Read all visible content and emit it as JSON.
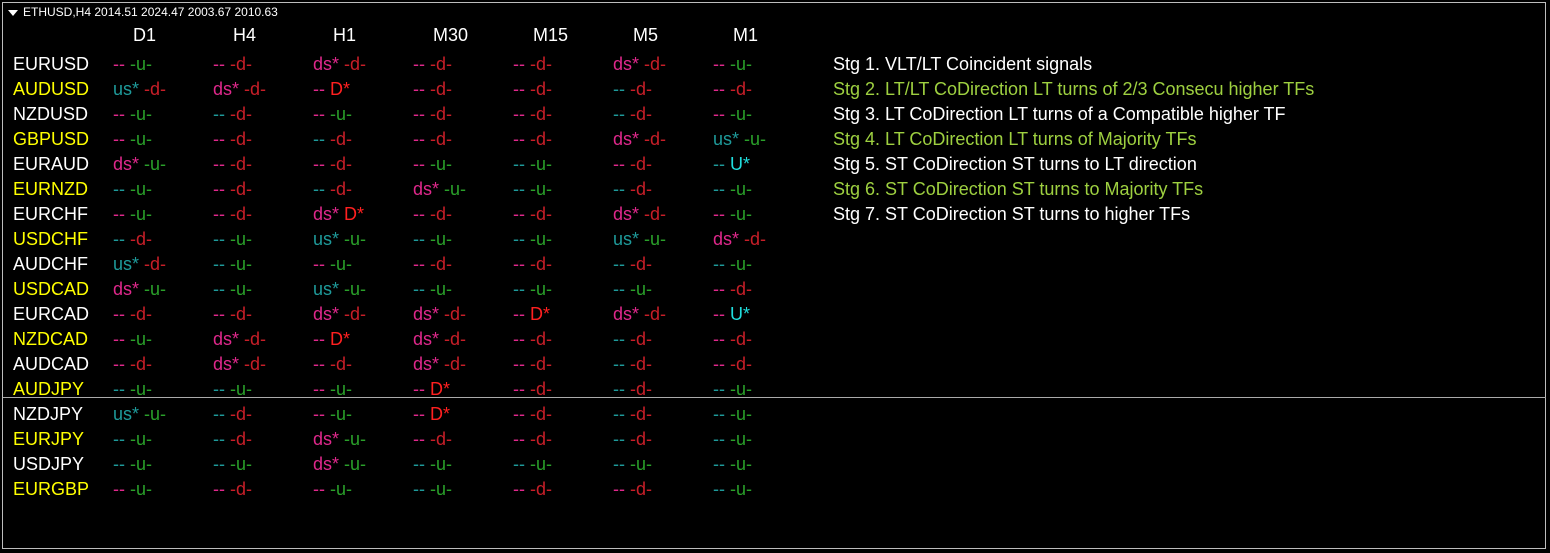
{
  "window_title": "ETHUSD,H4  2014.51 2024.47 2003.67 2010.63",
  "colors": {
    "bg": "#000000",
    "white": "#ffffff",
    "yellow": "#ffff00",
    "teal": "#1e9a9a",
    "magenta": "#e0288c",
    "red": "#ff2020",
    "darkred": "#c81e28",
    "green": "#2aa02a",
    "cyan": "#20dede",
    "lime": "#9ed040"
  },
  "timeframes": [
    "D1",
    "H4",
    "H1",
    "M30",
    "M15",
    "M5",
    "M1"
  ],
  "rows": [
    {
      "symbol": "EURUSD",
      "color": "white",
      "cells": [
        [
          "--",
          "magenta",
          "-u-",
          "green"
        ],
        [
          "--",
          "magenta",
          "-d-",
          "darkred"
        ],
        [
          "ds*",
          "magenta",
          "-d-",
          "darkred"
        ],
        [
          "--",
          "magenta",
          "-d-",
          "darkred"
        ],
        [
          "--",
          "magenta",
          "-d-",
          "darkred"
        ],
        [
          "ds*",
          "magenta",
          "-d-",
          "darkred"
        ],
        [
          "--",
          "magenta",
          "-u-",
          "green"
        ]
      ]
    },
    {
      "symbol": "AUDUSD",
      "color": "yellow",
      "cells": [
        [
          "us*",
          "teal",
          "-d-",
          "darkred"
        ],
        [
          "ds*",
          "magenta",
          "-d-",
          "darkred"
        ],
        [
          "--",
          "magenta",
          "D*",
          "red"
        ],
        [
          "--",
          "magenta",
          "-d-",
          "darkred"
        ],
        [
          "--",
          "magenta",
          "-d-",
          "darkred"
        ],
        [
          "--",
          "teal",
          "-d-",
          "darkred"
        ],
        [
          "--",
          "magenta",
          "-d-",
          "darkred"
        ]
      ]
    },
    {
      "symbol": "NZDUSD",
      "color": "white",
      "cells": [
        [
          "--",
          "magenta",
          "-u-",
          "green"
        ],
        [
          "--",
          "teal",
          "-d-",
          "darkred"
        ],
        [
          "--",
          "magenta",
          "-u-",
          "green"
        ],
        [
          "--",
          "magenta",
          "-d-",
          "darkred"
        ],
        [
          "--",
          "magenta",
          "-d-",
          "darkred"
        ],
        [
          "--",
          "teal",
          "-d-",
          "darkred"
        ],
        [
          "--",
          "magenta",
          "-u-",
          "green"
        ]
      ]
    },
    {
      "symbol": "GBPUSD",
      "color": "yellow",
      "cells": [
        [
          "--",
          "magenta",
          "-u-",
          "green"
        ],
        [
          "--",
          "magenta",
          "-d-",
          "darkred"
        ],
        [
          "--",
          "teal",
          "-d-",
          "darkred"
        ],
        [
          "--",
          "magenta",
          "-d-",
          "darkred"
        ],
        [
          "--",
          "magenta",
          "-d-",
          "darkred"
        ],
        [
          "ds*",
          "magenta",
          "-d-",
          "darkred"
        ],
        [
          "us*",
          "teal",
          "-u-",
          "green"
        ]
      ]
    },
    {
      "symbol": "EURAUD",
      "color": "white",
      "cells": [
        [
          "ds*",
          "magenta",
          "-u-",
          "green"
        ],
        [
          "--",
          "magenta",
          "-d-",
          "darkred"
        ],
        [
          "--",
          "magenta",
          "-d-",
          "darkred"
        ],
        [
          "--",
          "magenta",
          "-u-",
          "green"
        ],
        [
          "--",
          "teal",
          "-u-",
          "green"
        ],
        [
          "--",
          "magenta",
          "-d-",
          "darkred"
        ],
        [
          "--",
          "teal",
          "U*",
          "cyan"
        ]
      ]
    },
    {
      "symbol": "EURNZD",
      "color": "yellow",
      "cells": [
        [
          "--",
          "teal",
          "-u-",
          "green"
        ],
        [
          "--",
          "magenta",
          "-d-",
          "darkred"
        ],
        [
          "--",
          "teal",
          "-d-",
          "darkred"
        ],
        [
          "ds*",
          "magenta",
          "-u-",
          "green"
        ],
        [
          "--",
          "teal",
          "-u-",
          "green"
        ],
        [
          "--",
          "teal",
          "-d-",
          "darkred"
        ],
        [
          "--",
          "teal",
          "-u-",
          "green"
        ]
      ]
    },
    {
      "symbol": "EURCHF",
      "color": "white",
      "cells": [
        [
          "--",
          "magenta",
          "-u-",
          "green"
        ],
        [
          "--",
          "magenta",
          "-d-",
          "darkred"
        ],
        [
          "ds*",
          "magenta",
          "D*",
          "red"
        ],
        [
          "--",
          "magenta",
          "-d-",
          "darkred"
        ],
        [
          "--",
          "magenta",
          "-d-",
          "darkred"
        ],
        [
          "ds*",
          "magenta",
          "-d-",
          "darkred"
        ],
        [
          "--",
          "magenta",
          "-u-",
          "green"
        ]
      ]
    },
    {
      "symbol": "USDCHF",
      "color": "yellow",
      "cells": [
        [
          "--",
          "teal",
          "-d-",
          "darkred"
        ],
        [
          "--",
          "teal",
          "-u-",
          "green"
        ],
        [
          "us*",
          "teal",
          "-u-",
          "green"
        ],
        [
          "--",
          "teal",
          "-u-",
          "green"
        ],
        [
          "--",
          "teal",
          "-u-",
          "green"
        ],
        [
          "us*",
          "teal",
          "-u-",
          "green"
        ],
        [
          "ds*",
          "magenta",
          "-d-",
          "darkred"
        ]
      ]
    },
    {
      "symbol": "AUDCHF",
      "color": "white",
      "cells": [
        [
          "us*",
          "teal",
          "-d-",
          "darkred"
        ],
        [
          "--",
          "teal",
          "-u-",
          "green"
        ],
        [
          "--",
          "magenta",
          "-u-",
          "green"
        ],
        [
          "--",
          "magenta",
          "-d-",
          "darkred"
        ],
        [
          "--",
          "magenta",
          "-d-",
          "darkred"
        ],
        [
          "--",
          "teal",
          "-d-",
          "darkred"
        ],
        [
          "--",
          "teal",
          "-u-",
          "green"
        ]
      ]
    },
    {
      "symbol": "USDCAD",
      "color": "yellow",
      "cells": [
        [
          "ds*",
          "magenta",
          "-u-",
          "green"
        ],
        [
          "--",
          "teal",
          "-u-",
          "green"
        ],
        [
          "us*",
          "teal",
          "-u-",
          "green"
        ],
        [
          "--",
          "teal",
          "-u-",
          "green"
        ],
        [
          "--",
          "teal",
          "-u-",
          "green"
        ],
        [
          "--",
          "teal",
          "-u-",
          "green"
        ],
        [
          "--",
          "magenta",
          "-d-",
          "darkred"
        ]
      ]
    },
    {
      "symbol": "EURCAD",
      "color": "white",
      "cells": [
        [
          "--",
          "magenta",
          "-d-",
          "darkred"
        ],
        [
          "--",
          "magenta",
          "-d-",
          "darkred"
        ],
        [
          "ds*",
          "magenta",
          "-d-",
          "darkred"
        ],
        [
          "ds*",
          "magenta",
          "-d-",
          "darkred"
        ],
        [
          "--",
          "magenta",
          "D*",
          "red"
        ],
        [
          "ds*",
          "magenta",
          "-d-",
          "darkred"
        ],
        [
          "--",
          "magenta",
          "U*",
          "cyan"
        ]
      ]
    },
    {
      "symbol": "NZDCAD",
      "color": "yellow",
      "cells": [
        [
          "--",
          "magenta",
          "-u-",
          "green"
        ],
        [
          "ds*",
          "magenta",
          "-d-",
          "darkred"
        ],
        [
          "--",
          "magenta",
          "D*",
          "red"
        ],
        [
          "ds*",
          "magenta",
          "-d-",
          "darkred"
        ],
        [
          "--",
          "magenta",
          "-d-",
          "darkred"
        ],
        [
          "--",
          "teal",
          "-d-",
          "darkred"
        ],
        [
          "--",
          "magenta",
          "-d-",
          "darkred"
        ]
      ]
    },
    {
      "symbol": "AUDCAD",
      "color": "white",
      "cells": [
        [
          "--",
          "magenta",
          "-d-",
          "darkred"
        ],
        [
          "ds*",
          "magenta",
          "-d-",
          "darkred"
        ],
        [
          "--",
          "magenta",
          "-d-",
          "darkred"
        ],
        [
          "ds*",
          "magenta",
          "-d-",
          "darkred"
        ],
        [
          "--",
          "magenta",
          "-d-",
          "darkred"
        ],
        [
          "--",
          "teal",
          "-d-",
          "darkred"
        ],
        [
          "--",
          "magenta",
          "-d-",
          "darkred"
        ]
      ]
    },
    {
      "symbol": "AUDJPY",
      "color": "yellow",
      "cells": [
        [
          "--",
          "teal",
          "-u-",
          "green"
        ],
        [
          "--",
          "teal",
          "-u-",
          "green"
        ],
        [
          "--",
          "magenta",
          "-u-",
          "green"
        ],
        [
          "--",
          "magenta",
          "D*",
          "red"
        ],
        [
          "--",
          "magenta",
          "-d-",
          "darkred"
        ],
        [
          "--",
          "teal",
          "-d-",
          "darkred"
        ],
        [
          "--",
          "teal",
          "-u-",
          "green"
        ]
      ]
    },
    {
      "symbol": "NZDJPY",
      "color": "white",
      "cells": [
        [
          "us*",
          "teal",
          "-u-",
          "green"
        ],
        [
          "--",
          "teal",
          "-d-",
          "darkred"
        ],
        [
          "--",
          "magenta",
          "-u-",
          "green"
        ],
        [
          "--",
          "magenta",
          "D*",
          "red"
        ],
        [
          "--",
          "magenta",
          "-d-",
          "darkred"
        ],
        [
          "--",
          "teal",
          "-d-",
          "darkred"
        ],
        [
          "--",
          "teal",
          "-u-",
          "green"
        ]
      ]
    },
    {
      "symbol": "EURJPY",
      "color": "yellow",
      "cells": [
        [
          "--",
          "teal",
          "-u-",
          "green"
        ],
        [
          "--",
          "teal",
          "-d-",
          "darkred"
        ],
        [
          "ds*",
          "magenta",
          "-u-",
          "green"
        ],
        [
          "--",
          "magenta",
          "-d-",
          "darkred"
        ],
        [
          "--",
          "magenta",
          "-d-",
          "darkred"
        ],
        [
          "--",
          "teal",
          "-d-",
          "darkred"
        ],
        [
          "--",
          "teal",
          "-u-",
          "green"
        ]
      ]
    },
    {
      "symbol": "USDJPY",
      "color": "white",
      "cells": [
        [
          "--",
          "teal",
          "-u-",
          "green"
        ],
        [
          "--",
          "teal",
          "-u-",
          "green"
        ],
        [
          "ds*",
          "magenta",
          "-u-",
          "green"
        ],
        [
          "--",
          "teal",
          "-u-",
          "green"
        ],
        [
          "--",
          "teal",
          "-u-",
          "green"
        ],
        [
          "--",
          "teal",
          "-u-",
          "green"
        ],
        [
          "--",
          "teal",
          "-u-",
          "green"
        ]
      ]
    },
    {
      "symbol": "EURGBP",
      "color": "yellow",
      "cells": [
        [
          "--",
          "magenta",
          "-u-",
          "green"
        ],
        [
          "--",
          "magenta",
          "-d-",
          "darkred"
        ],
        [
          "--",
          "magenta",
          "-u-",
          "green"
        ],
        [
          "--",
          "teal",
          "-u-",
          "green"
        ],
        [
          "--",
          "magenta",
          "-d-",
          "darkred"
        ],
        [
          "--",
          "magenta",
          "-d-",
          "darkred"
        ],
        [
          "--",
          "teal",
          "-u-",
          "green"
        ]
      ]
    }
  ],
  "strategies": [
    {
      "text": "Stg 1. VLT/LT Coincident signals",
      "color": "white"
    },
    {
      "text": "Stg 2. LT/LT CoDirection LT turns of 2/3 Consecu higher TFs",
      "color": "lime"
    },
    {
      "text": "Stg 3. LT CoDirection LT turns of a Compatible higher TF",
      "color": "white"
    },
    {
      "text": "Stg 4. LT CoDirection LT turns of Majority TFs",
      "color": "lime"
    },
    {
      "text": "Stg 5. ST CoDirection ST turns to LT direction",
      "color": "white"
    },
    {
      "text": "Stg 6. ST CoDirection ST turns to Majority TFs",
      "color": "lime"
    },
    {
      "text": "Stg 7. ST CoDirection ST turns to higher TFs",
      "color": "white"
    }
  ]
}
